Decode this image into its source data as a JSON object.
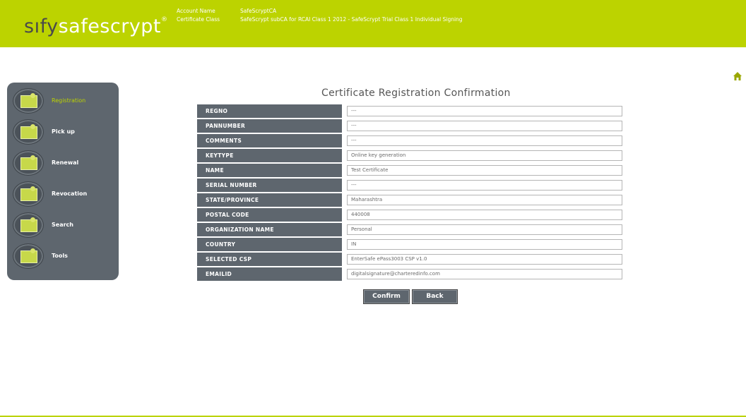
{
  "header": {
    "logo_sify": "sıfy",
    "logo_safescrypt": "safescrypt",
    "logo_mark": "®",
    "account_name_label": "Account Name",
    "account_name_value": "SafeScryptCA",
    "certificate_class_label": "Certificate Class",
    "certificate_class_value": "SafeScrypt subCA for RCAI Class 1 2012 - SafeScrypt Trial Class 1 Individual Signing",
    "brand_color": "#bcd300"
  },
  "sidebar": {
    "items": [
      {
        "label": "Registration",
        "icon": "certificate-edit-icon",
        "active": true
      },
      {
        "label": "Pick up",
        "icon": "certificate-download-icon"
      },
      {
        "label": "Renewal",
        "icon": "certificate-renew-icon"
      },
      {
        "label": "Revocation",
        "icon": "certificate-revoke-icon"
      },
      {
        "label": "Search",
        "icon": "certificate-search-icon"
      },
      {
        "label": "Tools",
        "icon": "certificate-tools-icon"
      }
    ]
  },
  "main": {
    "title": "Certificate Registration Confirmation",
    "home_icon": "home-icon",
    "rows": [
      {
        "label": "REGNO",
        "value": "---"
      },
      {
        "label": "PANNUMBER",
        "value": "---"
      },
      {
        "label": "COMMENTS",
        "value": "---"
      },
      {
        "label": "KEYTYPE",
        "value": "Online key generation"
      },
      {
        "label": "NAME",
        "value": "Test Certificate"
      },
      {
        "label": "SERIAL NUMBER",
        "value": "---"
      },
      {
        "label": "STATE/PROVINCE",
        "value": "Maharashtra"
      },
      {
        "label": "POSTAL CODE",
        "value": "440008"
      },
      {
        "label": "ORGANIZATION NAME",
        "value": "Personal"
      },
      {
        "label": "COUNTRY",
        "value": "IN"
      },
      {
        "label": "SELECTED CSP",
        "value": "EnterSafe ePass3003 CSP v1.0"
      },
      {
        "label": "EMAILID",
        "value": "digitalsignature@charteredinfo.com"
      }
    ],
    "confirm_label": "Confirm",
    "back_label": "Back"
  }
}
